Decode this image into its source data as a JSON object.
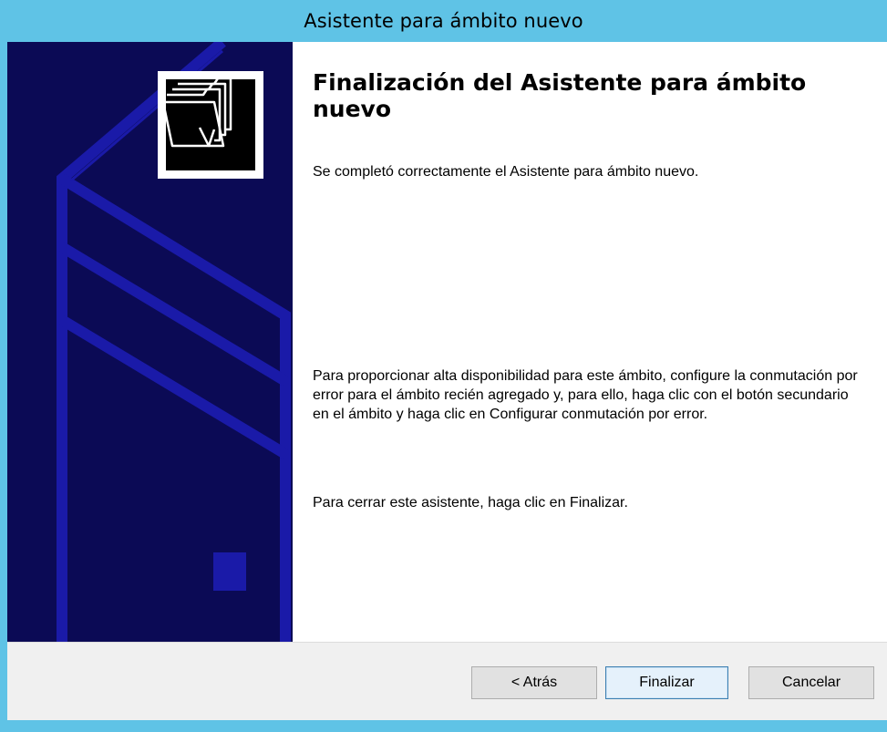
{
  "window": {
    "title": "Asistente para ámbito nuevo"
  },
  "sidebar": {
    "logo_icon": "folders-icon",
    "background": "#0b0a55",
    "line_color": "#1a1aa8"
  },
  "main": {
    "heading": "Finalización del Asistente para ámbito nuevo",
    "completed_text": "Se completó correctamente el Asistente para ámbito nuevo.",
    "failover_text": "Para proporcionar alta disponibilidad para este ámbito, configure la conmutación por error para el ámbito recién agregado y, para ello, haga clic con el botón secundario en el ámbito y haga clic en Configurar conmutación por error.",
    "close_text": "Para cerrar este asistente, haga clic en Finalizar."
  },
  "buttons": {
    "back_label": "< Atrás",
    "finish_label": "Finalizar",
    "cancel_label": "Cancelar"
  },
  "colors": {
    "titlebar": "#5fc3e6",
    "primary_border": "#3c7fb1"
  }
}
